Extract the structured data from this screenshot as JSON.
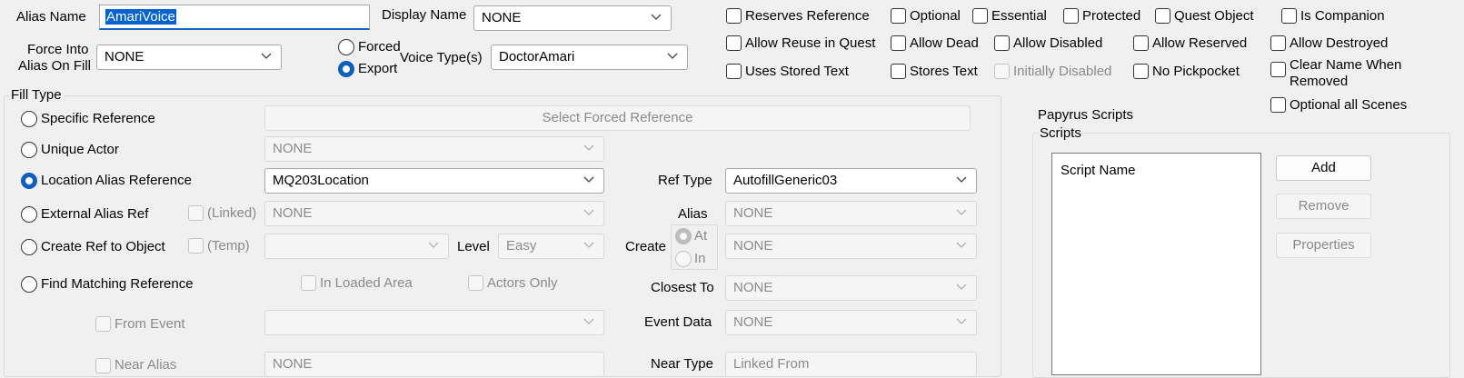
{
  "alias": {
    "name_label": "Alias Name",
    "name_value": "AmariVoice",
    "display_name_label": "Display Name",
    "display_name_value": "NONE",
    "force_into_label_1": "Force Into",
    "force_into_label_2": "Alias On Fill",
    "force_into_value": "NONE",
    "forced_label": "Forced",
    "export_label": "Export",
    "voice_types_label": "Voice Type(s)",
    "voice_types_value": "DoctorAmari"
  },
  "flags": {
    "reserves_reference": "Reserves Reference",
    "optional": "Optional",
    "essential": "Essential",
    "protected": "Protected",
    "quest_object": "Quest Object",
    "is_companion": "Is Companion",
    "allow_reuse": "Allow Reuse in Quest",
    "allow_dead": "Allow Dead",
    "allow_disabled": "Allow Disabled",
    "allow_reserved": "Allow Reserved",
    "allow_destroyed": "Allow Destroyed",
    "uses_stored_text": "Uses Stored Text",
    "stores_text": "Stores Text",
    "initially_disabled": "Initially Disabled",
    "no_pickpocket": "No Pickpocket",
    "clear_name_1": "Clear Name When",
    "clear_name_2": "Removed",
    "optional_all_scenes": "Optional all Scenes"
  },
  "fill_type": {
    "title": "Fill Type",
    "specific_reference": "Specific Reference",
    "select_forced_reference": "Select Forced Reference",
    "unique_actor": "Unique Actor",
    "unique_actor_value": "NONE",
    "location_alias_reference": "Location Alias Reference",
    "location_value": "MQ203Location",
    "ref_type_label": "Ref Type",
    "ref_type_value": "AutofillGeneric03",
    "external_alias_ref": "External Alias Ref",
    "linked_label": "(Linked)",
    "external_value": "NONE",
    "alias_label": "Alias",
    "alias_value": "NONE",
    "create_ref_to_object": "Create Ref to Object",
    "temp_label": "(Temp)",
    "create_obj_value": "",
    "level_label": "Level",
    "level_value": "Easy",
    "create_label": "Create",
    "at_label": "At",
    "in_label": "In",
    "create_value": "NONE",
    "find_matching_reference": "Find Matching Reference",
    "in_loaded_area": "In Loaded Area",
    "actors_only": "Actors Only",
    "closest_to_label": "Closest To",
    "closest_to_value": "NONE",
    "from_event": "From Event",
    "from_event_value": "",
    "event_data_label": "Event Data",
    "event_data_value": "NONE",
    "near_alias_partial": "Near Alias",
    "near_alias_value": "NONE",
    "near_type_label": "Near Type",
    "near_type_value": "Linked From"
  },
  "scripts": {
    "papyrus_title": "Papyrus Scripts",
    "group_title": "Scripts",
    "column_header": "Script Name",
    "add": "Add",
    "remove": "Remove",
    "properties": "Properties"
  }
}
